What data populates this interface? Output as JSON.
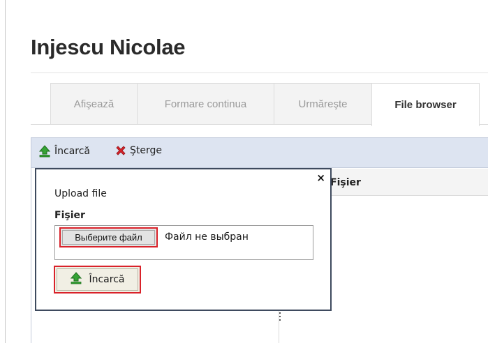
{
  "page": {
    "title": "Injescu Nicolae"
  },
  "tabs": [
    {
      "label": "Afişează",
      "active": false
    },
    {
      "label": "Formare continua",
      "active": false
    },
    {
      "label": "Urmăreşte",
      "active": false
    },
    {
      "label": "File browser",
      "active": true
    }
  ],
  "toolbar": {
    "upload_label": "Încarcă",
    "upload_icon": "upload-arrow-icon",
    "delete_label": "Şterge",
    "delete_icon": "red-x-icon"
  },
  "grid": {
    "column_header": "Fişier"
  },
  "upload_dialog": {
    "title": "Upload file",
    "field_label": "Fişier",
    "choose_button_label": "Выберите файл",
    "no_file_text": "Файл не выбран",
    "submit_label": "Încarcă",
    "close_glyph": "×"
  },
  "colors": {
    "toolbar_bg": "#dde4f1",
    "highlight": "#d9222a",
    "upload_icon": "#2e9a2e",
    "delete_icon": "#d9222a"
  }
}
